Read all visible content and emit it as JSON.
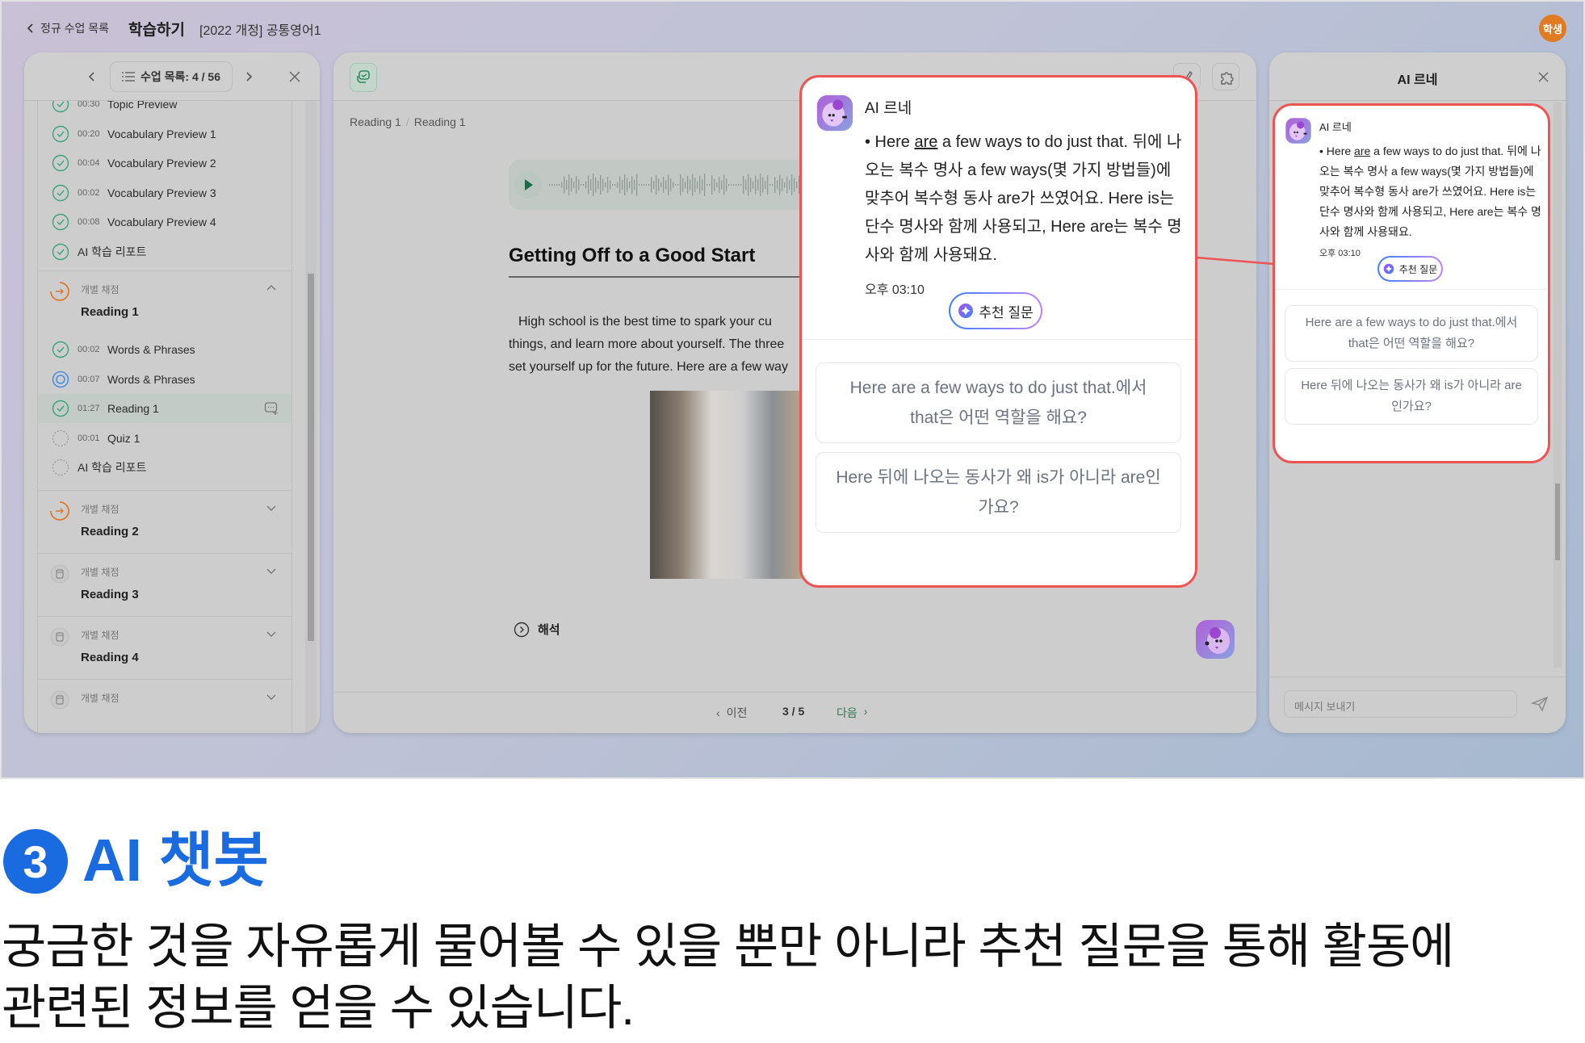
{
  "topbar": {
    "back_label": "정규 수업 목록",
    "title": "학습하기",
    "course": "[2022 개정] 공통영어1",
    "avatar": "학생"
  },
  "sidebar": {
    "header": {
      "lesson_list": "수업 목록: 4 / 56"
    },
    "items": [
      {
        "status": "done",
        "time": "00:30",
        "label": "Topic Preview"
      },
      {
        "status": "done",
        "time": "00:20",
        "label": "Vocabulary Preview 1"
      },
      {
        "status": "done",
        "time": "00:04",
        "label": "Vocabulary Preview 2"
      },
      {
        "status": "done",
        "time": "00:02",
        "label": "Vocabulary Preview 3"
      },
      {
        "status": "done",
        "time": "00:08",
        "label": "Vocabulary Preview 4"
      },
      {
        "status": "done",
        "time": "",
        "label": "AI 학습 리포트"
      }
    ],
    "groups": [
      {
        "status": "in-progress",
        "tag": "개별 채점",
        "title": "Reading 1",
        "expanded": true,
        "children": [
          {
            "status": "done",
            "time": "00:02",
            "label": "Words & Phrases"
          },
          {
            "status": "current",
            "time": "00:07",
            "label": "Words & Phrases"
          },
          {
            "status": "done",
            "time": "01:27",
            "label": "Reading 1",
            "active": true
          },
          {
            "status": "pending",
            "time": "00:01",
            "label": "Quiz 1"
          },
          {
            "status": "pending",
            "time": "",
            "label": "AI 학습 리포트"
          }
        ]
      },
      {
        "status": "in-progress",
        "tag": "개별 채점",
        "title": "Reading 2",
        "expanded": false
      },
      {
        "status": "locked",
        "tag": "개별 채점",
        "title": "Reading 3",
        "expanded": false
      },
      {
        "status": "locked",
        "tag": "개별 채점",
        "title": "Reading 4",
        "expanded": false
      },
      {
        "status": "locked",
        "tag": "개별 채점",
        "title": "",
        "expanded": false
      }
    ]
  },
  "content": {
    "breadcrumb": [
      "Reading 1",
      "Reading 1"
    ],
    "title": "Getting Off to a Good Start",
    "paragraph": [
      "High school is the best time to spark your cu",
      "things, and learn more about yourself. The three",
      "set yourself up for the future. Here are a few way"
    ],
    "translation_label": "해석",
    "pager": {
      "prev": "이전",
      "page": "3 / 5",
      "next": "다음"
    }
  },
  "chat": {
    "panel_title": "AI 르네",
    "bot_name": "AI 르네",
    "message": {
      "bullet": "• Here ",
      "underlined": "are",
      "rest": " a few ways to do just that. 뒤에 나오는 복수 명사 a few ways(몇 가지 방법들)에 맞추어 복수형 동사 are가 쓰였어요. Here is는 단수 명사와 함께 사용되고, Here are는 복수 명사와 함께 사용돼요."
    },
    "time": "오후 03:10",
    "recommend_label": "추천 질문",
    "suggestions": [
      "Here are a few ways to do just that.에서 that은 어떤 역할을 해요?",
      "Here 뒤에 나오는 동사가 왜 is가 아니라 are인가요?"
    ],
    "input_placeholder": "메시지 보내기"
  },
  "caption": {
    "number": "3",
    "title": "AI 챗봇",
    "lines": [
      "궁금한 것을 자유롭게 물어볼 수 있을 뿐만 아니라 추천 질문을 통해 활동에",
      "관련된 정보를 얻을 수 있습니다."
    ]
  },
  "colors": {
    "highlight": "#ef5454",
    "accent": "#1a6be0",
    "done": "#3aa57a",
    "current": "#4a90e2",
    "in_progress": "#e0782a",
    "avatar": "#e07b22"
  }
}
